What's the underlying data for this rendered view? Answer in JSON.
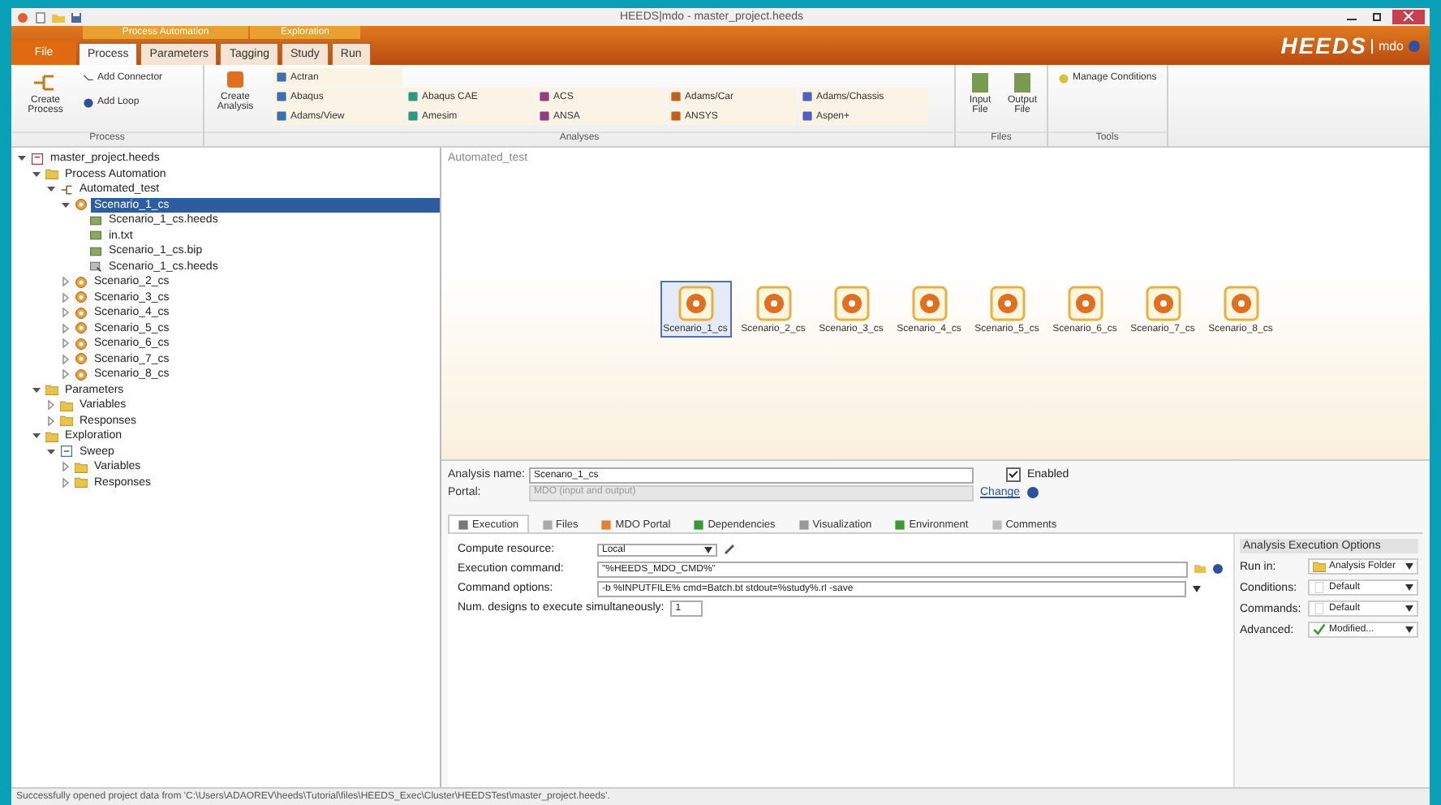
{
  "window": {
    "title": "HEEDS|mdo - master_project.heeds"
  },
  "ribbon": {
    "context_groups": [
      {
        "label": "Process Automation"
      },
      {
        "label": "Exploration"
      }
    ],
    "file_tab": "File",
    "tabs": [
      {
        "label": "Process",
        "selected": true
      },
      {
        "label": "Parameters",
        "selected": false
      },
      {
        "label": "Tagging",
        "selected": false
      },
      {
        "label": "Study",
        "selected": false
      },
      {
        "label": "Run",
        "selected": false
      }
    ],
    "logo": {
      "brand": "HEEDS",
      "suffix": "mdo"
    },
    "process_group": {
      "label": "Process",
      "create": "Create Process",
      "add_connector": "Add Connector",
      "add_loop": "Add Loop"
    },
    "analyses_group": {
      "label": "Analyses",
      "create": "Create Analysis",
      "gallery": [
        [
          "Actran"
        ],
        [
          "Abaqus",
          "Abaqus CAE",
          "ACS",
          "Adams/Car",
          "Adams/Chassis"
        ],
        [
          "Adams/View",
          "Amesim",
          "ANSA",
          "ANSYS",
          "Aspen+"
        ]
      ]
    },
    "files_group": {
      "label": "Files",
      "buttons": [
        "Input File",
        "Output File"
      ]
    },
    "tools_group": {
      "label": "Tools",
      "buttons": [
        "Manage Conditions"
      ]
    }
  },
  "tree": [
    {
      "label": "master_project.heeds",
      "kind": "project",
      "expanded": true,
      "selected": false,
      "children": [
        {
          "label": "Process Automation",
          "kind": "folder",
          "expanded": true,
          "selected": false,
          "children": [
            {
              "label": "Automated_test",
              "kind": "process",
              "expanded": true,
              "selected": false,
              "children": [
                {
                  "label": "Scenario_1_cs",
                  "kind": "analysis",
                  "expanded": true,
                  "selected": true,
                  "children": [
                    {
                      "label": "Scenario_1_cs.heeds",
                      "kind": "file",
                      "selected": false
                    },
                    {
                      "label": "in.txt",
                      "kind": "file",
                      "selected": false
                    },
                    {
                      "label": "Scenario_1_cs.bip",
                      "kind": "file",
                      "selected": false
                    },
                    {
                      "label": "Scenario_1_cs.heeds",
                      "kind": "link",
                      "selected": false
                    }
                  ]
                },
                {
                  "label": "Scenario_2_cs",
                  "kind": "analysis",
                  "expanded": false,
                  "selected": false
                },
                {
                  "label": "Scenario_3_cs",
                  "kind": "analysis",
                  "expanded": false,
                  "selected": false
                },
                {
                  "label": "Scenario_4_cs",
                  "kind": "analysis",
                  "expanded": false,
                  "selected": false
                },
                {
                  "label": "Scenario_5_cs",
                  "kind": "analysis",
                  "expanded": false,
                  "selected": false
                },
                {
                  "label": "Scenario_6_cs",
                  "kind": "analysis",
                  "expanded": false,
                  "selected": false
                },
                {
                  "label": "Scenario_7_cs",
                  "kind": "analysis",
                  "expanded": false,
                  "selected": false
                },
                {
                  "label": "Scenario_8_cs",
                  "kind": "analysis",
                  "expanded": false,
                  "selected": false
                }
              ]
            }
          ]
        },
        {
          "label": "Parameters",
          "kind": "folder",
          "expanded": true,
          "selected": false,
          "children": [
            {
              "label": "Variables",
              "kind": "folder",
              "expanded": false,
              "selected": false
            },
            {
              "label": "Responses",
              "kind": "folder",
              "expanded": false,
              "selected": false
            }
          ]
        },
        {
          "label": "Exploration",
          "kind": "folder",
          "expanded": true,
          "selected": false,
          "children": [
            {
              "label": "Sweep",
              "kind": "study",
              "expanded": true,
              "selected": false,
              "children": [
                {
                  "label": "Variables",
                  "kind": "folder",
                  "expanded": false,
                  "selected": false
                },
                {
                  "label": "Responses",
                  "kind": "folder",
                  "expanded": false,
                  "selected": false
                }
              ]
            }
          ]
        }
      ]
    }
  ],
  "canvas": {
    "title": "Automated_test",
    "nodes": [
      {
        "label": "Scenario_1_cs",
        "selected": true
      },
      {
        "label": "Scenario_2_cs",
        "selected": false
      },
      {
        "label": "Scenario_3_cs",
        "selected": false
      },
      {
        "label": "Scenario_4_cs",
        "selected": false
      },
      {
        "label": "Scenario_5_cs",
        "selected": false
      },
      {
        "label": "Scenario_6_cs",
        "selected": false
      },
      {
        "label": "Scenario_7_cs",
        "selected": false
      },
      {
        "label": "Scenario_8_cs",
        "selected": false
      }
    ]
  },
  "properties": {
    "name_label": "Analysis name:",
    "name_value": "Scenario_1_cs",
    "enabled_label": "Enabled",
    "enabled": true,
    "portal_label": "Portal:",
    "portal_value": "MDO (input and output)",
    "portal_disabled": true,
    "change_link": "Change",
    "tabs": [
      {
        "label": "Execution",
        "selected": true
      },
      {
        "label": "Files",
        "selected": false
      },
      {
        "label": "MDO Portal",
        "selected": false
      },
      {
        "label": "Dependencies",
        "selected": false
      },
      {
        "label": "Visualization",
        "selected": false
      },
      {
        "label": "Environment",
        "selected": false
      },
      {
        "label": "Comments",
        "selected": false
      }
    ],
    "compute_label": "Compute resource:",
    "compute_value": "Local",
    "exec_label": "Execution command:",
    "exec_value": "\"%HEEDS_MDO_CMD%\"",
    "options_label": "Command options:",
    "options_value": "-b %INPUTFILE% cmd=Batch.bt stdout=%study%.rl -save",
    "num_label": "Num. designs to execute simultaneously:",
    "num_value": "1",
    "exec_options": {
      "title": "Analysis Execution Options",
      "rows": [
        {
          "label": "Run in:",
          "value": "Analysis Folder",
          "kind": "folder"
        },
        {
          "label": "Conditions:",
          "value": "Default",
          "kind": "blank"
        },
        {
          "label": "Commands:",
          "value": "Default",
          "kind": "blank"
        },
        {
          "label": "Advanced:",
          "value": "Modified...",
          "kind": "check"
        }
      ]
    }
  },
  "status_bar": {
    "text": "Successfully opened project data from 'C:\\Users\\ADAOREV\\heeds\\Tutorial\\files\\HEEDS_Exec\\Cluster\\HEEDSTest\\master_project.heeds'."
  }
}
